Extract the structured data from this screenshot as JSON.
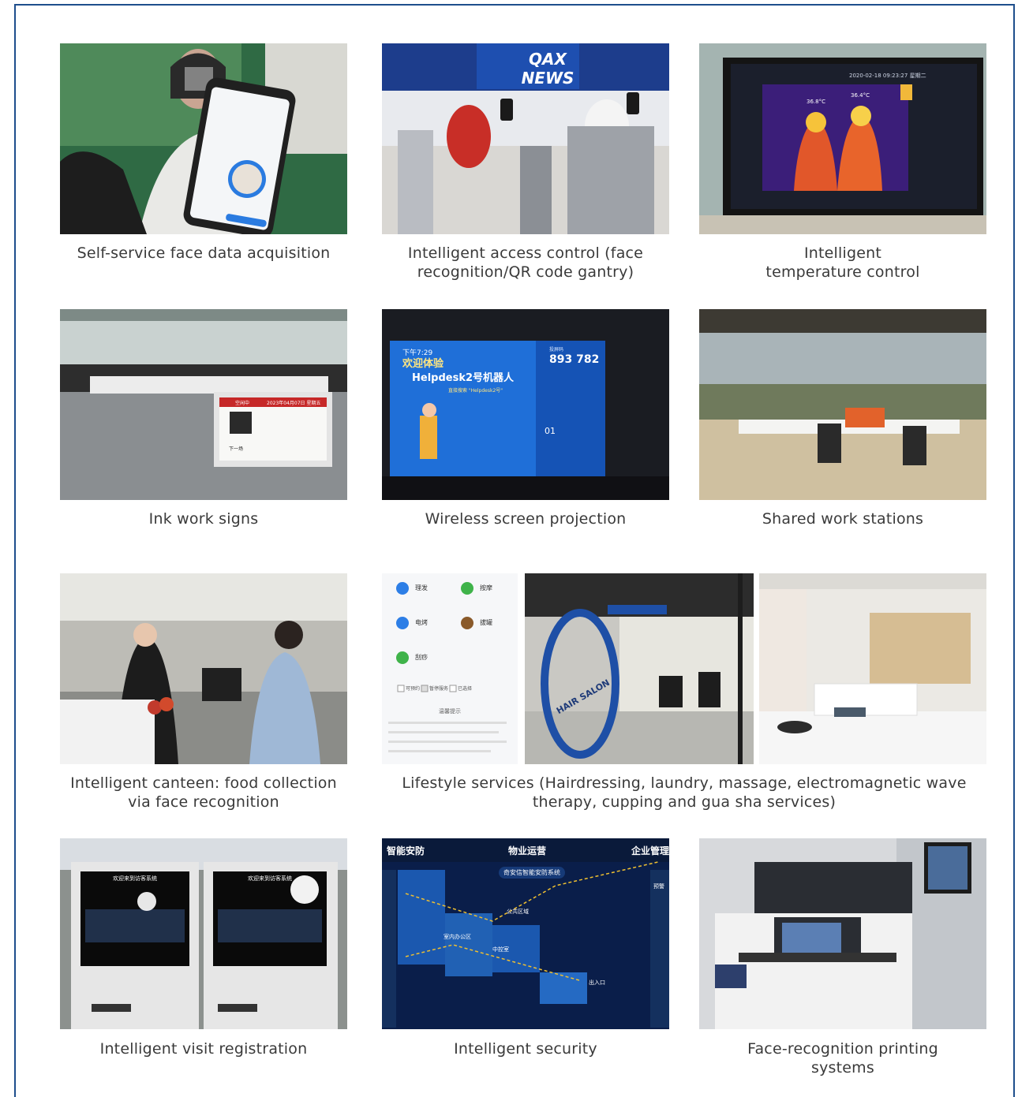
{
  "captions": {
    "face_acquisition": "Self-service face data acquisition",
    "access_control": "Intelligent access control (face recognition/QR code gantry)",
    "temperature": "Intelligent temperature control",
    "ink_signs": "Ink work signs",
    "screen_projection": "Wireless screen projection",
    "shared_stations": "Shared work stations",
    "canteen": "Intelligent canteen: food collection via face recognition",
    "lifestyle": "Lifestyle services (Hairdressing, laundry, massage, electromagnetic wave therapy, cupping and gua sha services)",
    "visit_registration": "Intelligent visit registration",
    "security": "Intelligent security",
    "printing": "Face-recognition printing systems"
  },
  "photo_text": {
    "news_sign": "QAX NEWS",
    "thermal_timestamp": "2020-02-18 09:23:27 星期二",
    "thermal_temp_1": "36.8°C",
    "thermal_temp_2": "36.4°C",
    "ink_sign_status": "空闲中",
    "ink_sign_date": "2023年04月07日 星期五",
    "ink_sign_next": "下一场",
    "projection_time": "下午7:29",
    "projection_welcome": "欢迎体验",
    "projection_title": "Helpdesk2号机器人",
    "projection_search": "直接搜索 \"Helpdesk2号\"",
    "projection_code_label": "投屏码",
    "projection_code": "893 782",
    "projection_day": "01",
    "lifestyle_menu": [
      "理发",
      "按摩",
      "电烤",
      "拔罐",
      "刮痧"
    ],
    "lifestyle_legend": [
      "可预约",
      "暂停服务",
      "已选择"
    ],
    "lifestyle_notice_title": "温馨提示",
    "salon_sign": "HAIR SALON",
    "kiosk_banner": "欢迎来到访客系统",
    "security_tabs": [
      "智能安防",
      "物业运营",
      "企业管理"
    ],
    "security_system": "奇安信智能安防系统",
    "security_labels": [
      "公共区域",
      "室内办公区",
      "中控室",
      "出入口",
      "预警"
    ]
  },
  "colors": {
    "frame_border": "#1e4e8c",
    "caption_text": "#3a3a3a"
  }
}
